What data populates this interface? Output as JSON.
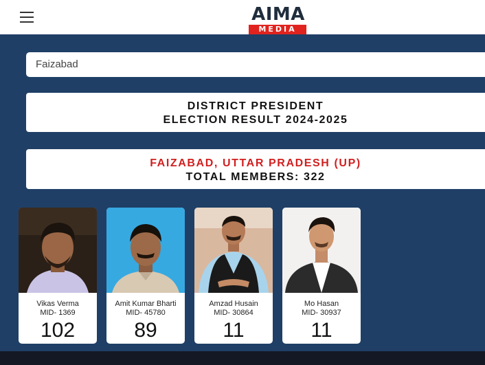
{
  "header": {
    "menu_icon": "hamburger-menu-icon",
    "logo_top": "AIMA",
    "logo_bottom": "MEDIA",
    "logo_colors": {
      "dark": "#1f2d3d",
      "red": "#e1231f"
    }
  },
  "search": {
    "value": "Faizabad"
  },
  "title_panel": {
    "line1": "DISTRICT PRESIDENT",
    "line2": "ELECTION RESULT 2024-2025"
  },
  "location_panel": {
    "line1": "FAIZABAD, UTTAR PRADESH (UP)",
    "line2": "TOTAL MEMBERS: 322",
    "accent_color": "#d11f1f"
  },
  "candidates": [
    {
      "name": "Vikas Verma",
      "mid": "MID- 1369",
      "votes": "102"
    },
    {
      "name": "Amit Kumar Bharti",
      "mid": "MID- 45780",
      "votes": "89"
    },
    {
      "name": "Amzad Husain",
      "mid": "MID- 30864",
      "votes": "11"
    },
    {
      "name": "Mo Hasan",
      "mid": "MID- 30937",
      "votes": "11"
    }
  ],
  "colors": {
    "background": "#1f3f66",
    "footer": "#141824"
  }
}
